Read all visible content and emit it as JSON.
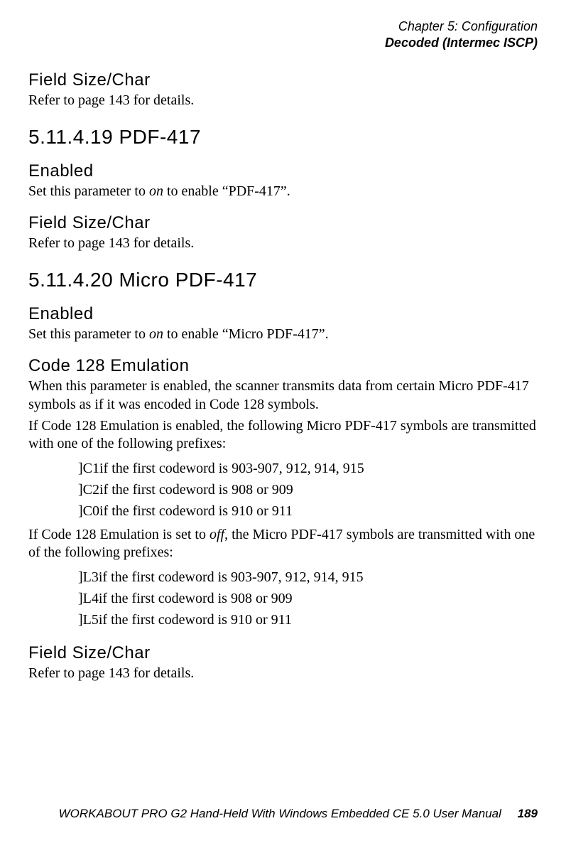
{
  "header": {
    "chapter": "Chapter 5: Configuration",
    "section": "Decoded (Intermec ISCP)"
  },
  "s1": {
    "heading": "Field Size/Char",
    "body": "Refer to page 143 for details."
  },
  "s2": {
    "heading": "5.11.4.19  PDF-417",
    "sub1": {
      "heading": "Enabled",
      "pre": "Set this parameter to ",
      "em": "on",
      "post": " to enable “PDF-417”."
    },
    "sub2": {
      "heading": "Field Size/Char",
      "body": "Refer to page 143 for details."
    }
  },
  "s3": {
    "heading": "5.11.4.20  Micro PDF-417",
    "sub1": {
      "heading": "Enabled",
      "pre": "Set this parameter to ",
      "em": "on",
      "post": " to enable “Micro PDF-417”."
    },
    "sub2": {
      "heading": "Code 128 Emulation",
      "p1": "When this parameter is enabled, the scanner transmits data from certain Micro PDF-417 symbols as if it was encoded in Code 128 symbols.",
      "p2": "If Code 128 Emulation is enabled, the following Micro PDF-417 symbols are transmitted with one of the following prefixes:",
      "list1": [
        "]C1if the first codeword is 903-907, 912, 914, 915",
        "]C2if the first codeword is 908 or 909",
        "]C0if the first codeword is 910 or 911"
      ],
      "p3_pre": "If Code 128 Emulation is set to ",
      "p3_em": "off",
      "p3_post": ", the Micro PDF-417 symbols are transmitted with one of the following prefixes:",
      "list2": [
        "]L3if the first codeword is 903-907, 912, 914, 915",
        "]L4if the first codeword is 908 or 909",
        "]L5if the first codeword is 910 or 911"
      ]
    },
    "sub3": {
      "heading": "Field Size/Char",
      "body": "Refer to page 143 for details."
    }
  },
  "footer": {
    "title": "WORKABOUT PRO G2 Hand-Held With Windows Embedded CE 5.0 User Manual",
    "page": "189"
  }
}
